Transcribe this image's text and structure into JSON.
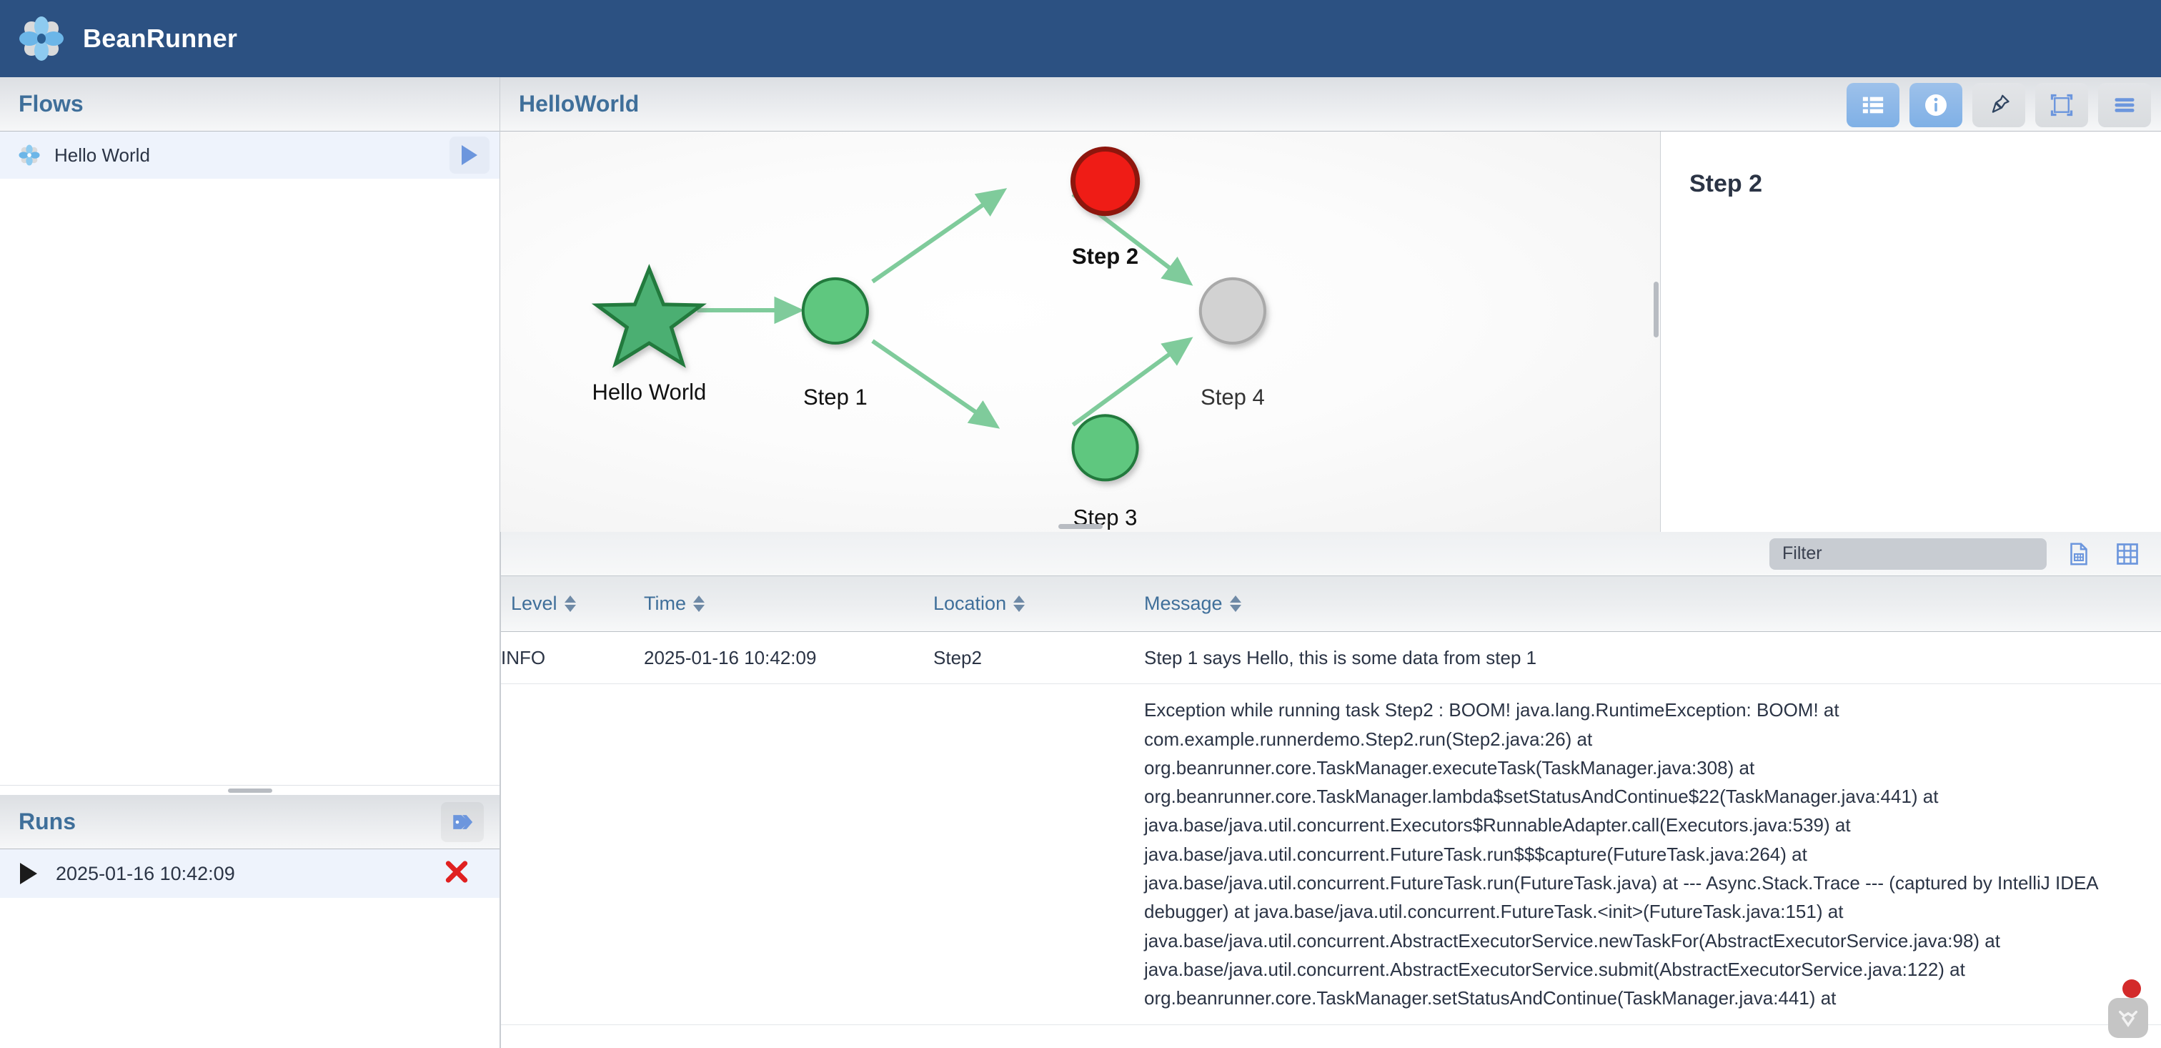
{
  "app": {
    "title": "BeanRunner",
    "logo_icon": "flower-logo-icon",
    "brand_color": "#2c5182"
  },
  "flows_panel": {
    "title": "Flows",
    "items": [
      {
        "label": "Hello World",
        "icon": "flower-icon",
        "run_icon": "play-icon",
        "selected": true
      }
    ]
  },
  "runs_panel": {
    "title": "Runs",
    "tag_icon": "tag-icon",
    "items": [
      {
        "expander_icon": "play-triangle-icon",
        "timestamp": "2025-01-16 10:42:09",
        "delete_icon": "close-x-icon"
      }
    ]
  },
  "main": {
    "title": "HelloWorld",
    "toolbar": [
      {
        "name": "list-view-button",
        "icon": "list-icon",
        "active": true
      },
      {
        "name": "info-button",
        "icon": "info-icon",
        "active": true
      },
      {
        "name": "pin-button",
        "icon": "pin-icon",
        "active": false
      },
      {
        "name": "fit-to-screen-button",
        "icon": "frame-icon",
        "active": false
      },
      {
        "name": "menu-button",
        "icon": "hamburger-icon",
        "active": false
      }
    ]
  },
  "graph": {
    "nodes": [
      {
        "id": "start",
        "label": "Hello World",
        "shape": "star",
        "status": "start",
        "color": "#4caf72"
      },
      {
        "id": "s1",
        "label": "Step 1",
        "shape": "circle",
        "status": "success",
        "color": "#5ec77f"
      },
      {
        "id": "s2",
        "label": "Step 2",
        "shape": "circle",
        "status": "error",
        "color": "#ef1b16",
        "selected": true
      },
      {
        "id": "s3",
        "label": "Step 3",
        "shape": "circle",
        "status": "success",
        "color": "#5ec77f"
      },
      {
        "id": "s4",
        "label": "Step 4",
        "shape": "circle",
        "status": "pending",
        "color": "#d2d2d2"
      }
    ],
    "edges": [
      {
        "from": "start",
        "to": "s1"
      },
      {
        "from": "s1",
        "to": "s2"
      },
      {
        "from": "s1",
        "to": "s3"
      },
      {
        "from": "s2",
        "to": "s4"
      },
      {
        "from": "s3",
        "to": "s4"
      }
    ],
    "edge_color": "#7fcb9b"
  },
  "detail_panel": {
    "title": "Step 2"
  },
  "filter_bar": {
    "placeholder": "Filter",
    "value": "",
    "export_icon": "export-document-icon",
    "grid_icon": "grid-table-icon"
  },
  "log_table": {
    "columns": [
      {
        "key": "level",
        "label": "Level",
        "sortable": true
      },
      {
        "key": "time",
        "label": "Time",
        "sortable": true
      },
      {
        "key": "location",
        "label": "Location",
        "sortable": true
      },
      {
        "key": "message",
        "label": "Message",
        "sortable": true
      }
    ],
    "rows": [
      {
        "level": "INFO",
        "time": "2025-01-16 10:42:09",
        "location": "Step2",
        "message": "Step 1 says Hello, this is some data from step 1"
      },
      {
        "level": "",
        "time": "",
        "location": "",
        "message": "Exception while running task Step2 : BOOM! java.lang.RuntimeException: BOOM! at com.example.runnerdemo.Step2.run(Step2.java:26) at org.beanrunner.core.TaskManager.executeTask(TaskManager.java:308) at org.beanrunner.core.TaskManager.lambda$setStatusAndContinue$22(TaskManager.java:441) at java.base/java.util.concurrent.Executors$RunnableAdapter.call(Executors.java:539) at java.base/java.util.concurrent.FutureTask.run$$$capture(FutureTask.java:264) at java.base/java.util.concurrent.FutureTask.run(FutureTask.java) at --- Async.Stack.Trace --- (captured by IntelliJ IDEA debugger) at java.base/java.util.concurrent.FutureTask.<init>(FutureTask.java:151) at java.base/java.util.concurrent.AbstractExecutorService.newTaskFor(AbstractExecutorService.java:98) at java.base/java.util.concurrent.AbstractExecutorService.submit(AbstractExecutorService.java:122) at org.beanrunner.core.TaskManager.setStatusAndContinue(TaskManager.java:441) at"
      }
    ]
  },
  "fab": {
    "icon": "collapse-down-icon",
    "badge": true,
    "badge_color": "#d32a2a"
  }
}
